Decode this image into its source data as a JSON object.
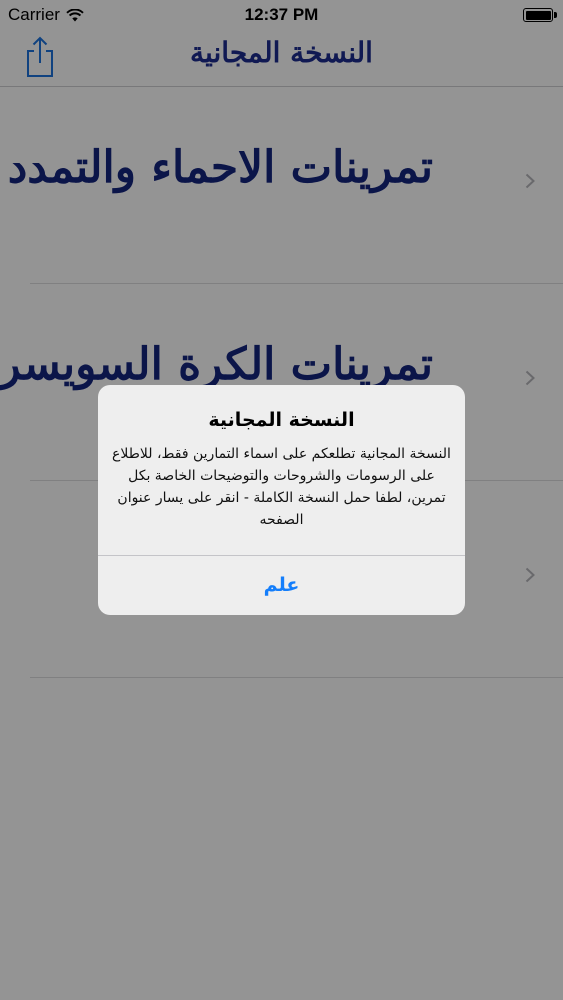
{
  "status_bar": {
    "carrier": "Carrier",
    "time": "12:37 PM"
  },
  "nav": {
    "title": "النسخة المجانية",
    "share_icon": "share-icon"
  },
  "list": {
    "items": [
      {
        "label": "تمرينات الاحماء والتمدد"
      },
      {
        "label": "تمرينات الكرة السويسرية"
      },
      {
        "label": ""
      }
    ],
    "chevron_icon": "chevron-right-icon"
  },
  "alert": {
    "title": "النسخة المجانية",
    "message": "النسخة المجانية تطلعكم على اسماء التمارين فقط، للاطلاع على الرسومات والشروحات والتوضيحات الخاصة بكل تمرين، لطفا حمل النسخة الكاملة - انقر على يسار عنوان الصفحه",
    "button_label": "علم"
  },
  "colors": {
    "accent": "#147efb",
    "title_text": "#1b2a8a"
  }
}
